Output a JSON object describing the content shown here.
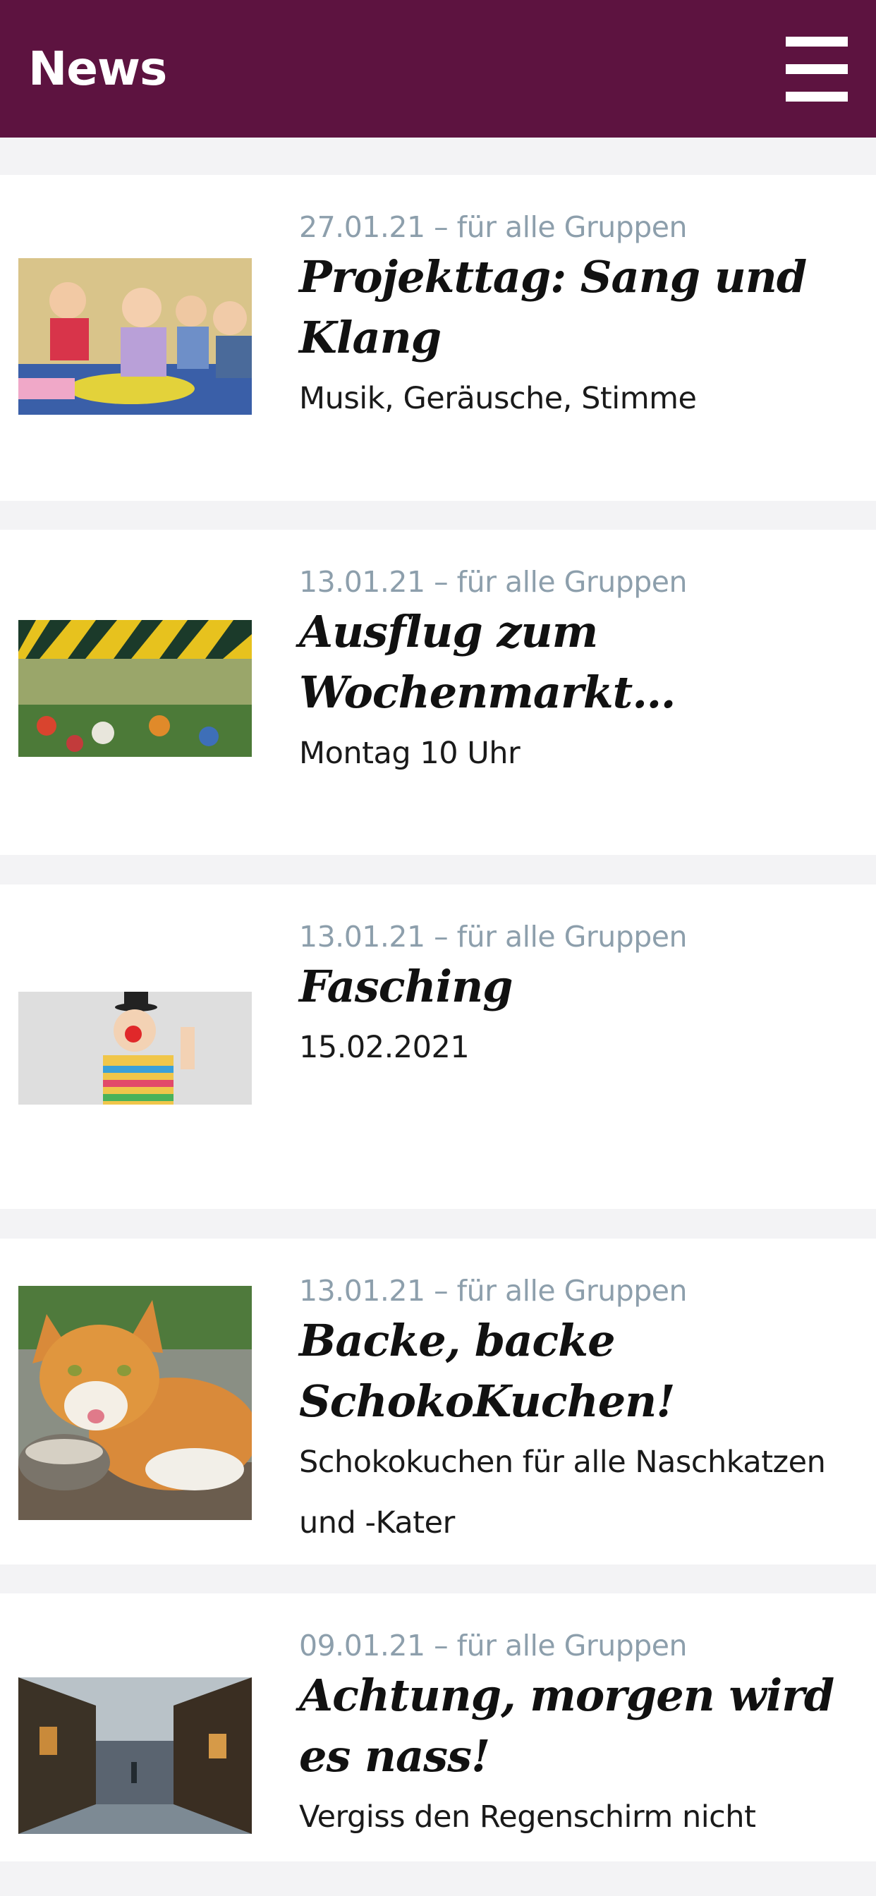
{
  "header": {
    "title": "News",
    "background": "#5d1340"
  },
  "items": [
    {
      "meta": "27.01.21 – für alle Gruppen",
      "title": "Projekttag: Sang und Klang",
      "description": "Musik, Geräusche, Stimme",
      "image": "children-music-photo"
    },
    {
      "meta": "13.01.21 – für alle Gruppen",
      "title": "Ausflug zum Wochenmarkt…",
      "description": "Montag 10 Uhr",
      "image": "market-stall-photo"
    },
    {
      "meta": "13.01.21 – für alle Gruppen",
      "title": "Fasching",
      "description": "15.02.2021",
      "image": "clown-child-photo"
    },
    {
      "meta": "13.01.21 – für alle Gruppen",
      "title": "Backe, backe SchokoKuchen!",
      "description": "Schokokuchen für alle  Naschkatzen und -Kater",
      "image": "cat-photo"
    },
    {
      "meta": "09.01.21 – für alle Gruppen",
      "title": "Achtung, morgen wird es nass!",
      "description": "Vergiss den  Regenschirm nicht",
      "image": "rainy-street-photo"
    }
  ]
}
